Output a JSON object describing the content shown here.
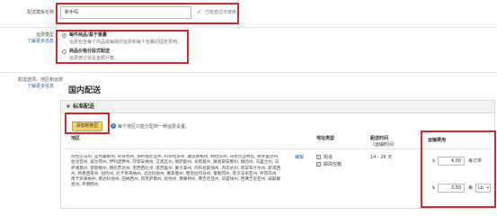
{
  "name_field": {
    "label": "配送模板名称",
    "value": "新手吗",
    "check_text": "已检查过可使用。"
  },
  "shipping_mode": {
    "label": "运费模型",
    "help_link": "了解更多信息",
    "options": [
      {
        "title": "每件商品/基于重量",
        "desc": "运费包含每个商品或每磅的运费和每个包裹的固定费用。",
        "selected": true
      },
      {
        "title": "商品价格分段式配送",
        "desc": "运费按订单总金额计算。",
        "selected": false
      }
    ]
  },
  "region_setting": {
    "label": "配送选项、地区和运费",
    "help_link": "了解更多信息"
  },
  "domestic": {
    "title": "国内配送",
    "panel_title": "标准配送",
    "collapse_icon": "triangle-down",
    "add_button": "添加新地区",
    "add_hint": "每个地区只能分配到一种运费设置。",
    "headers": {
      "region": "地区",
      "address_type": "地址类型",
      "transit_time": "配送时间",
      "transit_note": "（运输时间）",
      "shipping_fee": "运输费用"
    },
    "regions_text": "阿拉巴马州, 亚利桑那州, 阿肯色州, 加利福尼亚州, 科罗拉多州, 康涅狄格州, 特拉华州, 哥伦比亚特区, 佛罗里达州, 佐治亚州, 爱达荷州, 伊利诺伊州, 印第安纳州, 艾奥瓦州, 堪萨斯州, 肯塔基州, 路易斯安那州, 缅因州, 马里兰州, 马萨诸塞州, 密歇根州, 明尼苏达州, 密西西比州, 密苏里州, 蒙大拿州, 内布拉斯加州, 内华达州, 新罕布什尔州, 新泽西州, 新墨西哥州, 纽约州, 北卡罗来纳州, 北达科他州, 俄亥俄州, 俄克拉何马州, 俄勒冈州, 宾夕法尼亚州, 罗得岛州, 南卡罗来纳州, 南达科他州, 田纳西州, 得克萨斯州, 犹他州, 佛蒙特州, 弗吉尼亚州, 华盛顿州, 西弗吉尼亚州, 威斯康星州, 怀俄明州",
    "edit_link": "编辑",
    "address_types": [
      {
        "label": "街道",
        "checked": true
      },
      {
        "label": "邮政信箱",
        "checked": true
      }
    ],
    "transit_time": "14 - 26 天",
    "fees": [
      {
        "currency": "$",
        "value": "4.00",
        "unit_label": "每订单"
      },
      {
        "currency": "$",
        "value": "3.50",
        "unit_label": "每",
        "unit": "Lb"
      }
    ]
  }
}
